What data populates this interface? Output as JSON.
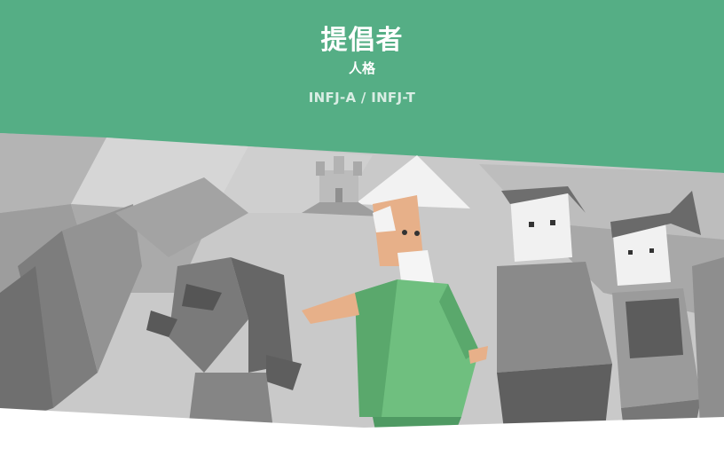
{
  "header": {
    "title": "提倡者",
    "subtitle": "人格",
    "type_codes": "INFJ-A / INFJ-T"
  },
  "colors": {
    "header_background": "#55ae85",
    "header_text": "#ffffff",
    "mentor_robe": "#6fbf7f"
  },
  "illustration": {
    "icons": [
      "castle-icon",
      "mentor-character",
      "male-character",
      "female-character",
      "stone-creature",
      "gray-trees"
    ]
  }
}
